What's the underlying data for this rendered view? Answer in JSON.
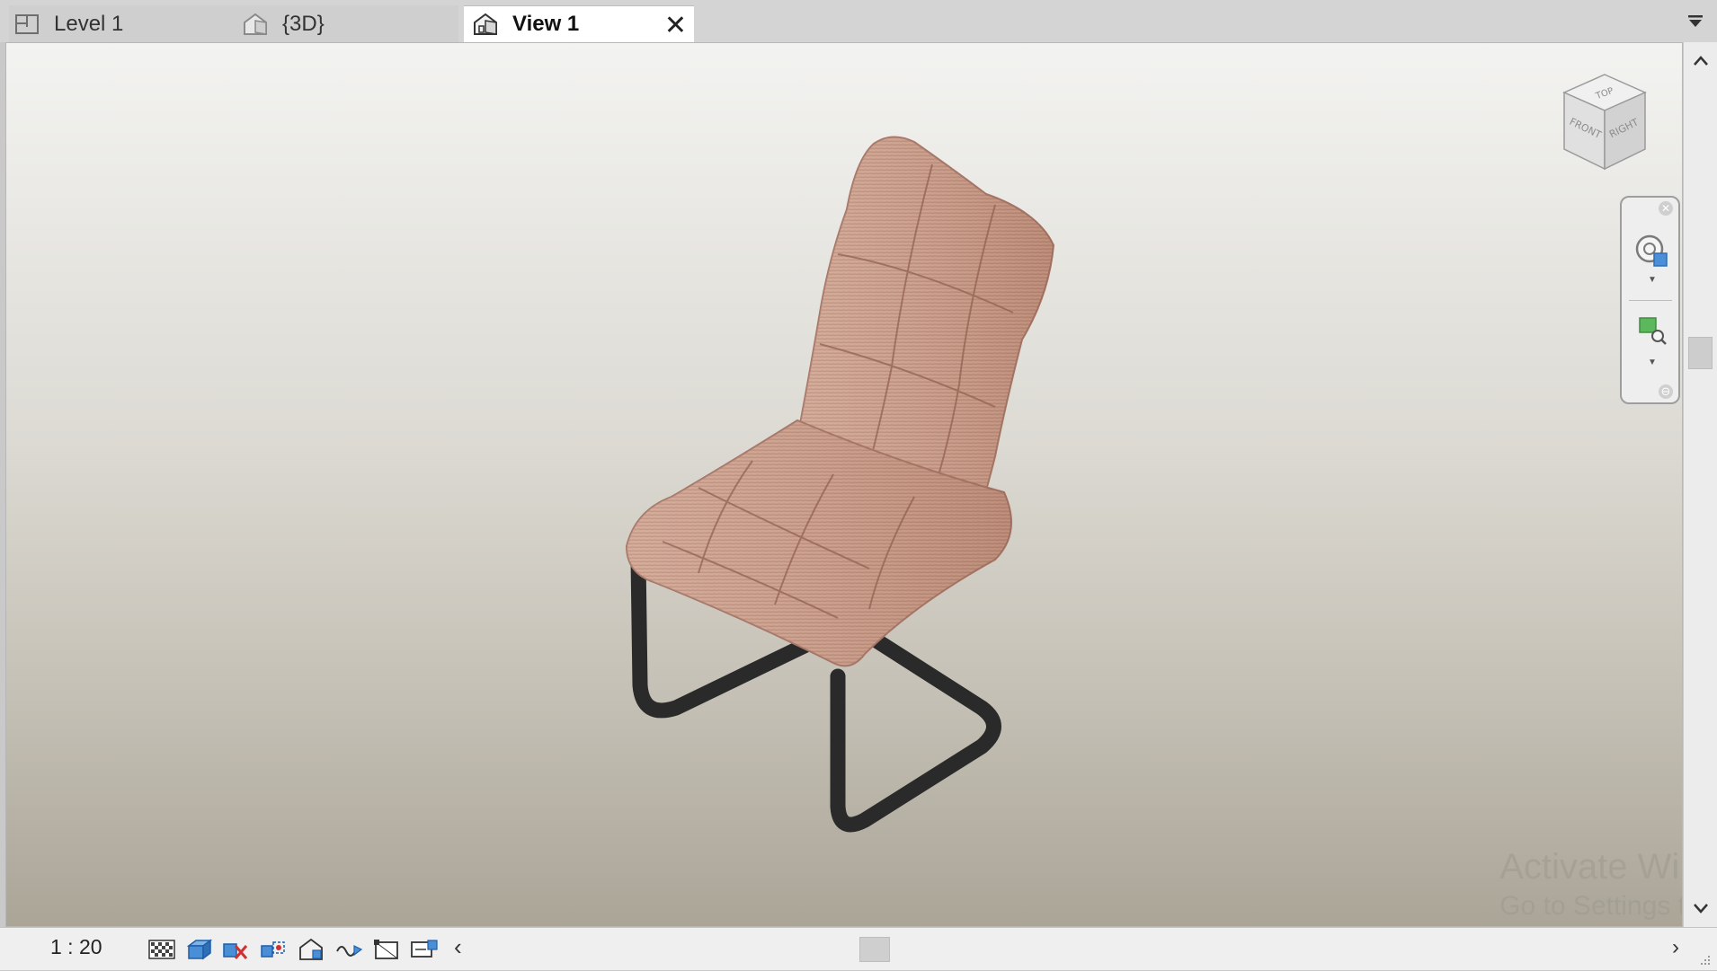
{
  "tabs": [
    {
      "label": "Level 1",
      "icon": "floor-plan-icon",
      "active": false
    },
    {
      "label": "{3D}",
      "icon": "house-3d-icon",
      "active": false
    },
    {
      "label": "View 1",
      "icon": "house-3d-icon",
      "active": true
    }
  ],
  "close_label": "✕",
  "viewcube": {
    "top": "TOP",
    "front": "FRONT",
    "right": "RIGHT"
  },
  "view": {
    "scale": "1 : 20",
    "watermark_line1": "Activate Wi",
    "watermark_line2": "Go to Settings t"
  },
  "view_controls": [
    {
      "icon": "detail-level-icon"
    },
    {
      "icon": "visual-style-icon"
    },
    {
      "icon": "temporary-hide-icon"
    },
    {
      "icon": "reveal-hidden-icon"
    },
    {
      "icon": "analytical-model-icon"
    },
    {
      "icon": "highlight-displacement-icon"
    },
    {
      "icon": "crop-view-icon"
    },
    {
      "icon": "show-crop-region-icon"
    }
  ],
  "colors": {
    "chair_fabric": "#c89a86",
    "chair_frame": "#2a2a2a",
    "viewport_top": "#f3f3f1",
    "viewport_bottom": "#aaa597"
  }
}
